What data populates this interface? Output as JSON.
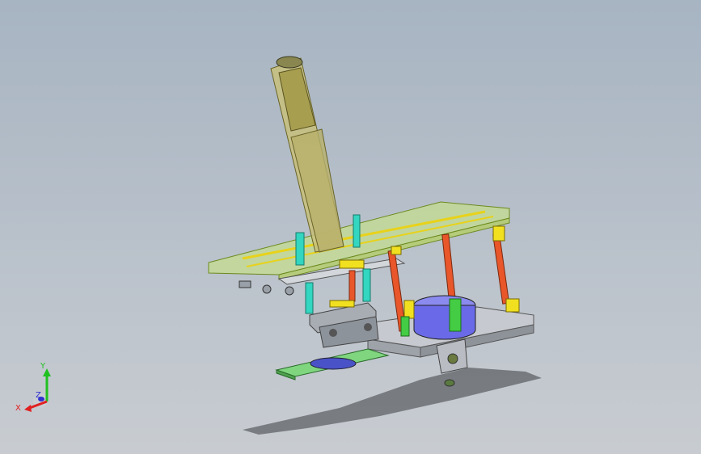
{
  "viewport": {
    "background_top": "#a7b4c2",
    "background_bottom": "#c8ccd1"
  },
  "triad": {
    "x_label": "X",
    "y_label": "Y",
    "z_label": "Z",
    "x_color": "#e02020",
    "y_color": "#20c020",
    "z_color": "#3030d0"
  },
  "model_colors": {
    "plate_transparent": "#c9e87a",
    "actuator_body": "#c8c07a",
    "rod_cyan": "#33d6c0",
    "rod_orange": "#e8562a",
    "rod_yellow": "#f0e020",
    "motor_blue": "#6a6ae8",
    "base_plate": "#c0c4cc",
    "green_flange": "#66cc66"
  }
}
